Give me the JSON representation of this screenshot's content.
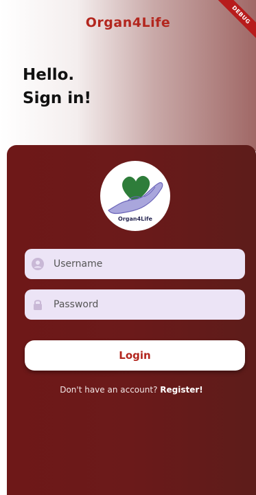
{
  "header": {
    "app_title": "Organ4Life",
    "greeting_line1": "Hello.",
    "greeting_line2": "Sign in!",
    "debug_label": "DEBUG"
  },
  "logo": {
    "label": "Organ4Life"
  },
  "form": {
    "username": {
      "placeholder": "Username",
      "value": "",
      "icon": "person-icon"
    },
    "password": {
      "placeholder": "Password",
      "value": "",
      "icon": "lock-icon"
    },
    "login_label": "Login",
    "register_prompt": "Don't have an account?",
    "register_link": "Register!"
  },
  "colors": {
    "accent": "#b3261e",
    "card_background": "#6b1a1a",
    "field_background": "#ece4f6"
  }
}
